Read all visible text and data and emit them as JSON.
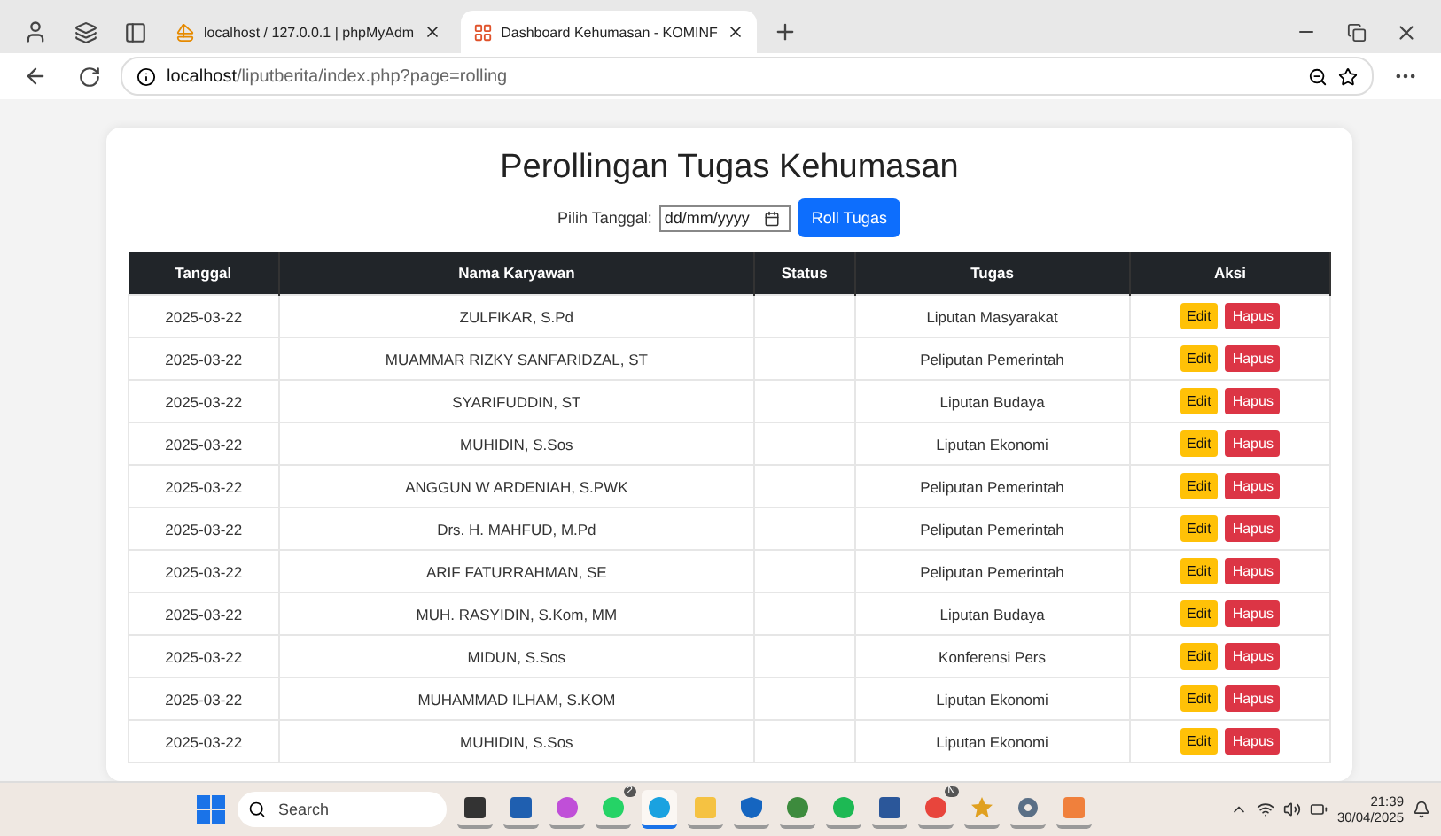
{
  "browser": {
    "tabs": [
      {
        "title": "localhost / 127.0.0.1 | phpMyAdm",
        "kind": "sail",
        "selected": false
      },
      {
        "title": "Dashboard Kehumasan - KOMINF",
        "kind": "grid",
        "selected": true
      }
    ],
    "address": {
      "host": "localhost",
      "path": "/liputberita/index.php?page=rolling"
    }
  },
  "page": {
    "title": "Perollingan Tugas Kehumasan",
    "date_label": "Pilih Tanggal:",
    "date_placeholder": "dd/mm/yyyy",
    "roll_button": "Roll Tugas",
    "table": {
      "columns": [
        "Tanggal",
        "Nama Karyawan",
        "Status",
        "Tugas",
        "Aksi"
      ],
      "rows": [
        {
          "date": "2025-03-22",
          "name": "ZULFIKAR, S.Pd",
          "task": "Liputan Masyarakat",
          "edit": "Edit",
          "delete": "Hapus"
        },
        {
          "date": "2025-03-22",
          "name": "MUAMMAR RIZKY SANFARIDZAL, ST",
          "task": "Peliputan Pemerintah",
          "edit": "Edit",
          "delete": "Hapus"
        },
        {
          "date": "2025-03-22",
          "name": "SYARIFUDDIN, ST",
          "task": "Liputan Budaya",
          "edit": "Edit",
          "delete": "Hapus"
        },
        {
          "date": "2025-03-22",
          "name": "MUHIDIN, S.Sos",
          "task": "Liputan Ekonomi",
          "edit": "Edit",
          "delete": "Hapus"
        },
        {
          "date": "2025-03-22",
          "name": "ANGGUN W ARDENIAH, S.PWK",
          "task": "Peliputan Pemerintah",
          "edit": "Edit",
          "delete": "Hapus"
        },
        {
          "date": "2025-03-22",
          "name": "Drs. H. MAHFUD, M.Pd",
          "task": "Peliputan Pemerintah",
          "edit": "Edit",
          "delete": "Hapus"
        },
        {
          "date": "2025-03-22",
          "name": "ARIF FATURRAHMAN, SE",
          "task": "Peliputan Pemerintah",
          "edit": "Edit",
          "delete": "Hapus"
        },
        {
          "date": "2025-03-22",
          "name": "MUH. RASYIDIN, S.Kom, MM",
          "task": "Liputan Budaya",
          "edit": "Edit",
          "delete": "Hapus"
        },
        {
          "date": "2025-03-22",
          "name": "MIDUN, S.Sos",
          "task": "Konferensi Pers",
          "edit": "Edit",
          "delete": "Hapus"
        },
        {
          "date": "2025-03-22",
          "name": "MUHAMMAD ILHAM, S.KOM",
          "task": "Liputan Ekonomi",
          "edit": "Edit",
          "delete": "Hapus"
        },
        {
          "date": "2025-03-22",
          "name": "MUHIDIN, S.Sos",
          "task": "Liputan Ekonomi",
          "edit": "Edit",
          "delete": "Hapus"
        }
      ]
    }
  },
  "taskbar": {
    "search_placeholder": "Search",
    "apps": [
      {
        "kind": "square",
        "color": "#333333",
        "selected": false
      },
      {
        "kind": "square",
        "color": "#1f5fb0",
        "selected": false
      },
      {
        "kind": "circle",
        "color": "#c04fd8",
        "selected": false
      },
      {
        "kind": "circle",
        "color": "#25d366",
        "selected": false,
        "badge": "2"
      },
      {
        "kind": "circle",
        "color": "#1aa2e0",
        "selected": true
      },
      {
        "kind": "square",
        "color": "#f5c242",
        "selected": false
      },
      {
        "kind": "shield",
        "color": "#1565c0",
        "selected": false
      },
      {
        "kind": "circle",
        "color": "#3d8b3d",
        "selected": false
      },
      {
        "kind": "circle",
        "color": "#1db954",
        "selected": false
      },
      {
        "kind": "square",
        "color": "#2b579a",
        "selected": false
      },
      {
        "kind": "circle",
        "color": "#e8453c",
        "selected": false,
        "badge": "N"
      },
      {
        "kind": "star",
        "color": "#e0a020",
        "selected": false
      },
      {
        "kind": "gear",
        "color": "#5a6f86",
        "selected": false
      },
      {
        "kind": "square",
        "color": "#f0803c",
        "selected": false
      }
    ],
    "time": "21:39",
    "date": "30/04/2025"
  }
}
